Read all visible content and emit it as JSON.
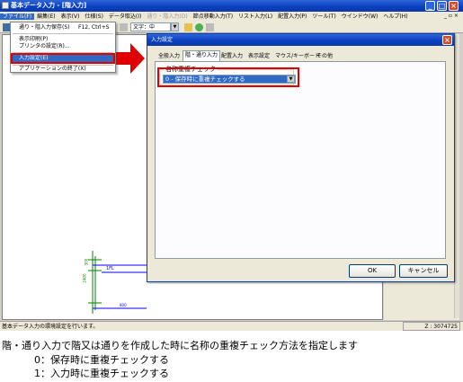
{
  "window": {
    "title": "基本データ入力 - [階入力]"
  },
  "menu": [
    "ファイル(F)",
    "編集(E)",
    "表示(V)",
    "仕様(S)",
    "データ取込(I)",
    "通り・階入力(D)",
    "節点移動入力(T)",
    "リスト入力(L)",
    "配置入力(P)",
    "ツール(T)",
    "ウインドウ(W)",
    "ヘルプ(H)"
  ],
  "toolbar": {
    "font_select": "文字：中"
  },
  "file_menu": [
    {
      "label": "通り・階入力保存(S)",
      "shortcut": "F12, Ctrl+S"
    },
    {
      "label": "表示印刷(P)",
      "shortcut": ""
    },
    {
      "label": "プリンタの設定(R)...",
      "shortcut": ""
    },
    {
      "label": "入力設定(E)",
      "shortcut": ""
    },
    {
      "label": "アプリケーションの終了(X)",
      "shortcut": ""
    }
  ],
  "dialog": {
    "title": "入力設定",
    "tabs": [
      "全般入力",
      "階・通り入力",
      "配置入力",
      "表示設定",
      "マウス/キーボード",
      "その他"
    ],
    "group_label": "名称重複チェック",
    "select_value": "0 - 保存時に重複チェックする",
    "ok_label": "OK",
    "cancel_label": "キャンセル"
  },
  "canvas": {
    "labels": [
      "1FL",
      "2400",
      "300",
      "800"
    ]
  },
  "status": {
    "left": "基本データ入力の環境設定を行います。",
    "right": "Z : 3074725"
  },
  "caption": {
    "line1": "階・通り入力で階又は通りを作成した時に名称の重複チェック方法を指定します",
    "line2": "0：保存時に重複チェックする",
    "line3": "1：入力時に重複チェックする"
  },
  "colors": {
    "titlebar": "#0a3fc0",
    "highlight": "#316ac5",
    "callout_red": "#e00000"
  }
}
